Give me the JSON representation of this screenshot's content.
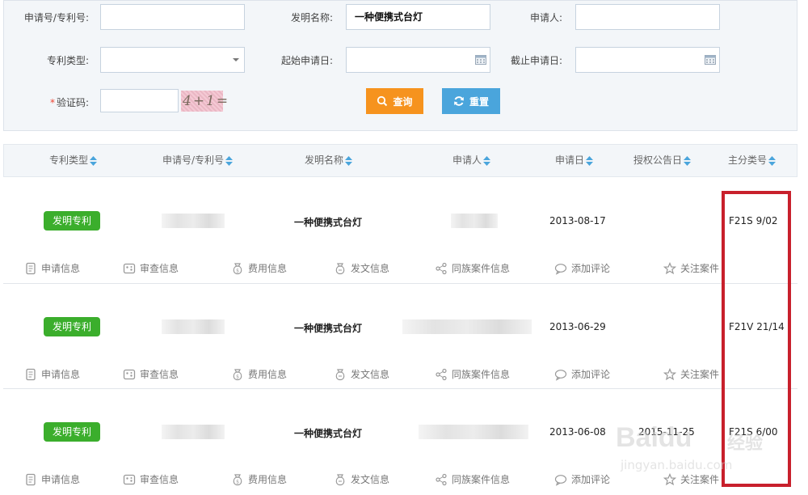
{
  "search": {
    "app_no_label": "申请号/专利号:",
    "app_no_value": "",
    "title_label": "发明名称:",
    "title_value": "一种便携式台灯",
    "applicant_label": "申请人:",
    "applicant_value": "",
    "type_label": "专利类型:",
    "type_value": "",
    "start_label": "起始申请日:",
    "start_value": "",
    "end_label": "截止申请日:",
    "end_value": "",
    "captcha_required_mark": "*",
    "captcha_label": "验证码:",
    "captcha_value": "",
    "captcha_image_text": "4+1=",
    "query_button": "查询",
    "reset_button": "重置"
  },
  "columns": [
    "专利类型",
    "申请号/专利号",
    "发明名称",
    "申请人",
    "申请日",
    "授权公告日",
    "主分类号"
  ],
  "records": [
    {
      "type": "发明专利",
      "title": "一种便携式台灯",
      "apply_date": "2013-08-17",
      "grant_date": "",
      "main_class": "F21S 9/02"
    },
    {
      "type": "发明专利",
      "title": "一种便携式台灯",
      "apply_date": "2013-06-29",
      "grant_date": "",
      "main_class": "F21V 21/14"
    },
    {
      "type": "发明专利",
      "title": "一种便携式台灯",
      "apply_date": "2013-06-08",
      "grant_date": "2015-11-25",
      "main_class": "F21S 6/00"
    }
  ],
  "actions": [
    "申请信息",
    "审查信息",
    "费用信息",
    "发文信息",
    "同族案件信息",
    "添加评论",
    "关注案件"
  ],
  "watermark": {
    "brand": "Baidu",
    "suffix": "经验",
    "url": "jingyan.baidu.com"
  },
  "colors": {
    "badge": "#3bae2c",
    "query": "#f6931e",
    "reset": "#4aa5dc",
    "highlight_box": "#c8202c"
  }
}
